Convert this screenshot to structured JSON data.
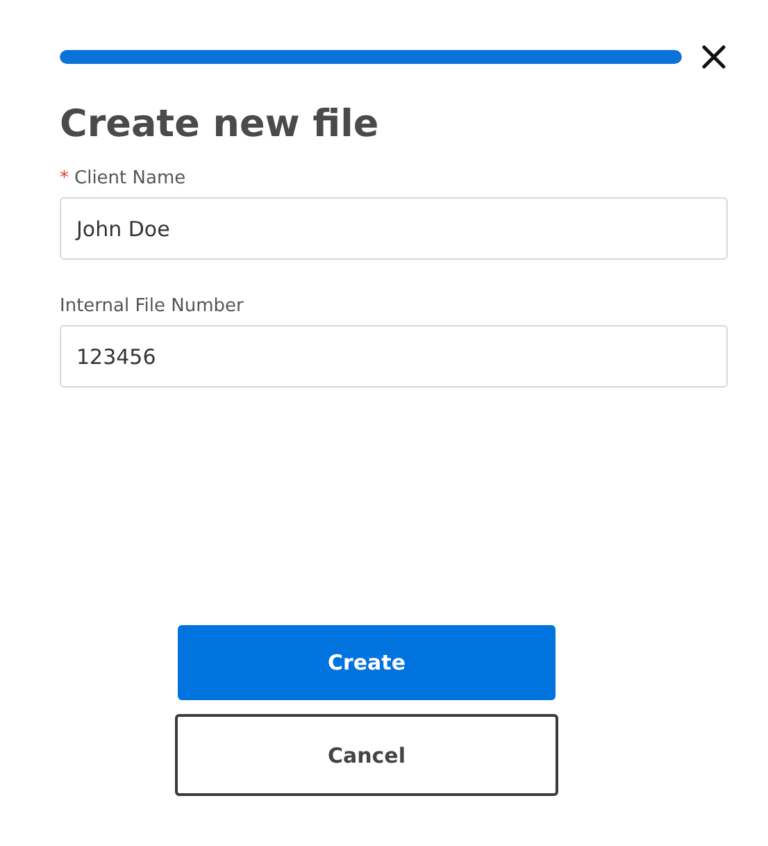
{
  "progress": {
    "level": 1
  },
  "title": "Create new file",
  "fields": [
    {
      "label": "Client Name",
      "required_marker": "*",
      "value": "John Doe"
    },
    {
      "label": "Internal File Number",
      "value": "123456"
    }
  ],
  "buttons": [
    {
      "label": "Create",
      "kind": "primary"
    },
    {
      "label": "Cancel",
      "kind": "secondary"
    }
  ]
}
